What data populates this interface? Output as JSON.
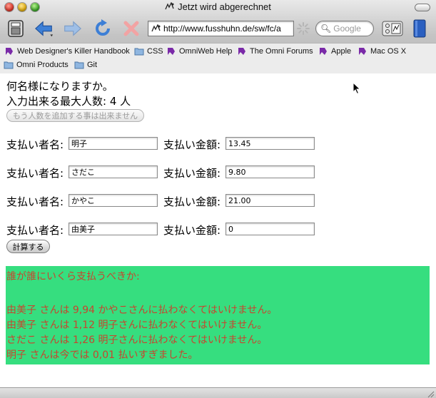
{
  "window": {
    "title": "Jetzt wird abgerechnet"
  },
  "toolbar": {
    "address_url": "http://www.fusshuhn.de/sw/fc/a",
    "search_placeholder": "Google"
  },
  "bookmarks": {
    "items": [
      {
        "label": "Web Designer's Killer Handbook",
        "icon": "bookmark-icon"
      },
      {
        "label": "CSS",
        "icon": "folder-icon"
      },
      {
        "label": "OmniWeb Help",
        "icon": "bookmark-icon"
      },
      {
        "label": "The Omni Forums",
        "icon": "bookmark-icon"
      },
      {
        "label": "Apple",
        "icon": "bookmark-icon"
      },
      {
        "label": "Mac OS X",
        "icon": "bookmark-icon"
      },
      {
        "label": "Omni Products",
        "icon": "folder-icon"
      },
      {
        "label": "Git",
        "icon": "folder-icon"
      }
    ]
  },
  "page": {
    "question": "何名様になりますか。",
    "max_people_label": "入力出来る最大人数: 4 人",
    "add_person_button": "もう人数を追加する事は出来ません",
    "payer_label": "支払い者名:",
    "amount_label": "支払い金額:",
    "entries": [
      {
        "name": "明子",
        "amount": "13.45"
      },
      {
        "name": "さだこ",
        "amount": "9.80"
      },
      {
        "name": "かやこ",
        "amount": "21.00"
      },
      {
        "name": "由美子",
        "amount": "0"
      }
    ],
    "calculate_button": "計算する",
    "result": {
      "heading": "誰が誰にいくら支払うべきか:",
      "lines": [
        "由美子 さんは 9,94 かやこさんに払わなくてはいけません。",
        "由美子 さんは 1,12 明子さんに払わなくてはいけません。",
        "さだこ さんは 1,26 明子さんに払わなくてはいけません。",
        "明子 さんは今では 0,01 払いすぎました。"
      ]
    }
  },
  "colors": {
    "result_background": "#36de7f",
    "result_text": "#c7452e"
  }
}
